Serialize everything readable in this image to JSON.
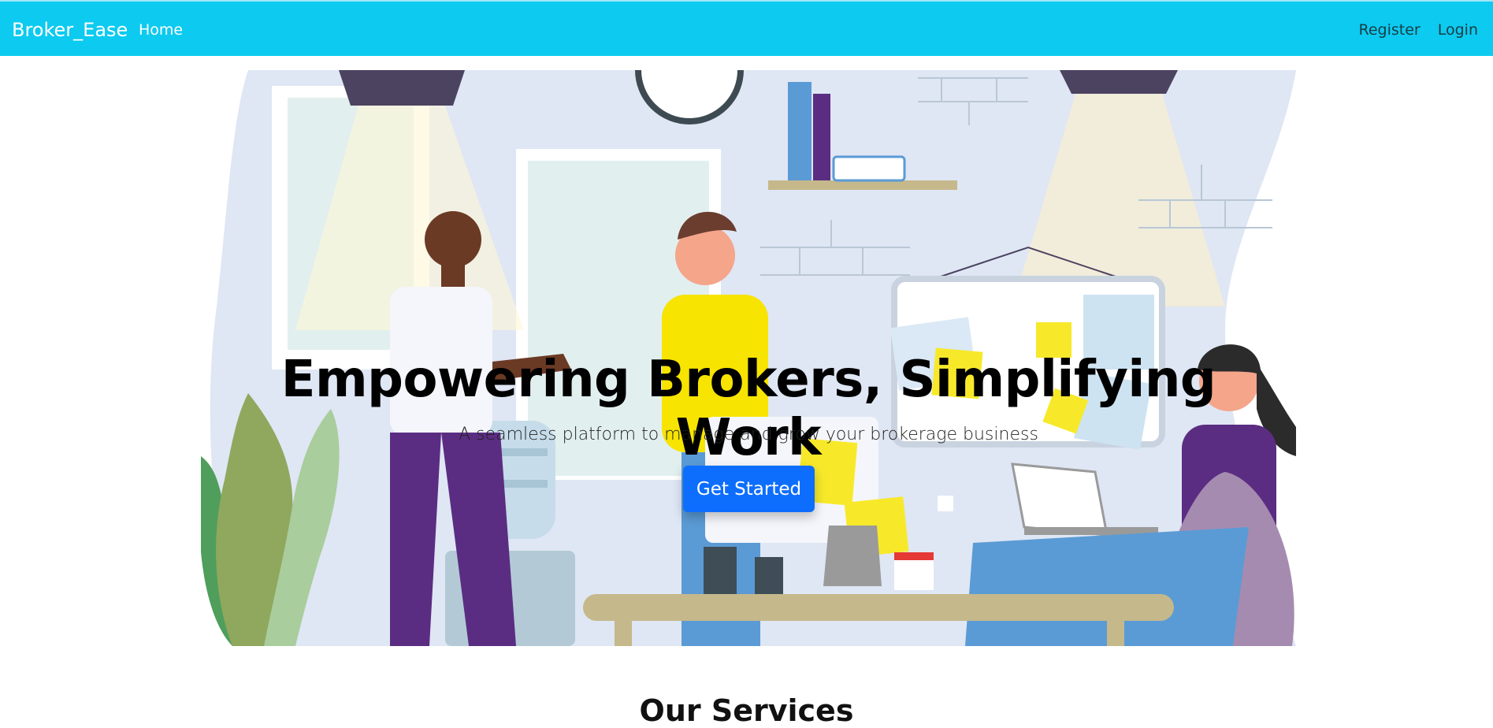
{
  "navbar": {
    "brand": "Broker_Ease",
    "home": "Home",
    "register": "Register",
    "login": "Login"
  },
  "hero": {
    "title": "Empowering Brokers, Simplifying Work",
    "subtitle": "A seamless platform to manage and grow your brokerage business",
    "cta": "Get Started",
    "illustration": "office-team-illustration"
  },
  "services": {
    "title": "Our Services"
  },
  "colors": {
    "navbar": "#0dcaf0",
    "cta": "#0d6efd"
  }
}
